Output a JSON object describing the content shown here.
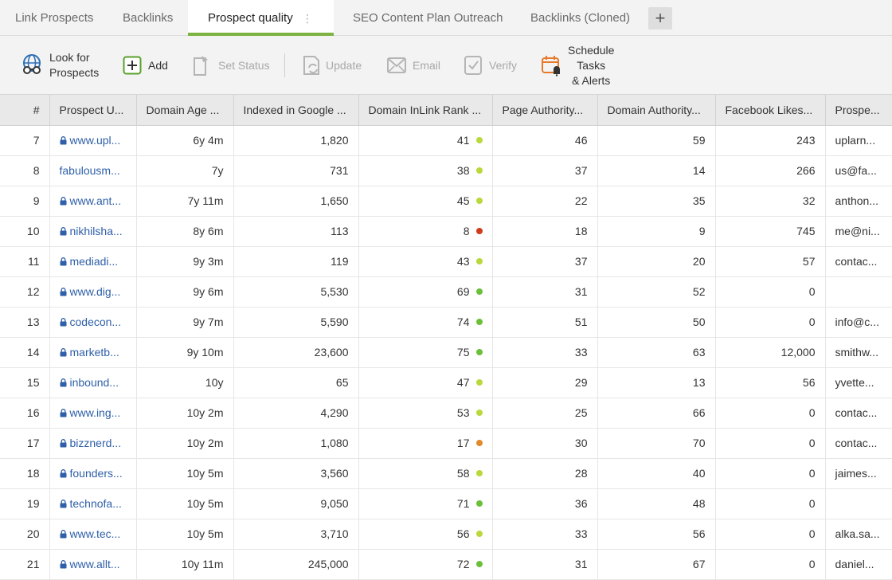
{
  "tabs": [
    {
      "label": "Link Prospects",
      "active": false
    },
    {
      "label": "Backlinks",
      "active": false
    },
    {
      "label": "Prospect quality",
      "active": true
    },
    {
      "label": "SEO Content Plan Outreach",
      "active": false
    },
    {
      "label": "Backlinks (Cloned)",
      "active": false
    }
  ],
  "add_tab_label": "+",
  "toolbar": {
    "look_for_prospects": [
      "Look for",
      "Prospects"
    ],
    "add": "Add",
    "set_status": "Set Status",
    "update": "Update",
    "email": "Email",
    "verify": "Verify",
    "schedule": [
      "Schedule",
      "Tasks",
      "& Alerts"
    ]
  },
  "colors": {
    "accent": "#7cb342",
    "link": "#2e5fa8",
    "rank_high": "#6cbf3a",
    "rank_mid": "#b9d83b",
    "rank_low_orange": "#e08a2c",
    "rank_low_red": "#d13a1c"
  },
  "table": {
    "columns": [
      "#",
      "Prospect U...",
      "Domain Age ...",
      "Indexed in Google ...",
      "Domain InLink Rank ...",
      "Page Authority...",
      "Domain Authority...",
      "Facebook Likes...",
      "Prospe..."
    ],
    "rows": [
      {
        "n": "7",
        "url": "www.upl...",
        "secure": true,
        "age": "6y 4m",
        "indexed": "1,820",
        "rank": "41",
        "rank_color": "mid",
        "pa": "46",
        "da": "59",
        "fb": "243",
        "email": "uplarn..."
      },
      {
        "n": "8",
        "url": "fabulousm...",
        "secure": false,
        "age": "7y",
        "indexed": "731",
        "rank": "38",
        "rank_color": "mid",
        "pa": "37",
        "da": "14",
        "fb": "266",
        "email": "us@fa..."
      },
      {
        "n": "9",
        "url": "www.ant...",
        "secure": true,
        "age": "7y 11m",
        "indexed": "1,650",
        "rank": "45",
        "rank_color": "mid",
        "pa": "22",
        "da": "35",
        "fb": "32",
        "email": "anthon..."
      },
      {
        "n": "10",
        "url": "nikhilsha...",
        "secure": true,
        "age": "8y 6m",
        "indexed": "113",
        "rank": "8",
        "rank_color": "red",
        "pa": "18",
        "da": "9",
        "fb": "745",
        "email": "me@ni..."
      },
      {
        "n": "11",
        "url": "mediadi...",
        "secure": true,
        "age": "9y 3m",
        "indexed": "119",
        "rank": "43",
        "rank_color": "mid",
        "pa": "37",
        "da": "20",
        "fb": "57",
        "email": "contac..."
      },
      {
        "n": "12",
        "url": "www.dig...",
        "secure": true,
        "age": "9y 6m",
        "indexed": "5,530",
        "rank": "69",
        "rank_color": "high",
        "pa": "31",
        "da": "52",
        "fb": "0",
        "email": ""
      },
      {
        "n": "13",
        "url": "codecon...",
        "secure": true,
        "age": "9y 7m",
        "indexed": "5,590",
        "rank": "74",
        "rank_color": "high",
        "pa": "51",
        "da": "50",
        "fb": "0",
        "email": "info@c..."
      },
      {
        "n": "14",
        "url": "marketb...",
        "secure": true,
        "age": "9y 10m",
        "indexed": "23,600",
        "rank": "75",
        "rank_color": "high",
        "pa": "33",
        "da": "63",
        "fb": "12,000",
        "email": "smithw..."
      },
      {
        "n": "15",
        "url": "inbound...",
        "secure": true,
        "age": "10y",
        "indexed": "65",
        "rank": "47",
        "rank_color": "mid",
        "pa": "29",
        "da": "13",
        "fb": "56",
        "email": "yvette..."
      },
      {
        "n": "16",
        "url": "www.ing...",
        "secure": true,
        "age": "10y 2m",
        "indexed": "4,290",
        "rank": "53",
        "rank_color": "mid",
        "pa": "25",
        "da": "66",
        "fb": "0",
        "email": "contac..."
      },
      {
        "n": "17",
        "url": "bizznerd...",
        "secure": true,
        "age": "10y 2m",
        "indexed": "1,080",
        "rank": "17",
        "rank_color": "orange",
        "pa": "30",
        "da": "70",
        "fb": "0",
        "email": "contac..."
      },
      {
        "n": "18",
        "url": "founders...",
        "secure": true,
        "age": "10y 5m",
        "indexed": "3,560",
        "rank": "58",
        "rank_color": "mid",
        "pa": "28",
        "da": "40",
        "fb": "0",
        "email": "jaimes..."
      },
      {
        "n": "19",
        "url": "technofa...",
        "secure": true,
        "age": "10y 5m",
        "indexed": "9,050",
        "rank": "71",
        "rank_color": "high",
        "pa": "36",
        "da": "48",
        "fb": "0",
        "email": ""
      },
      {
        "n": "20",
        "url": "www.tec...",
        "secure": true,
        "age": "10y 5m",
        "indexed": "3,710",
        "rank": "56",
        "rank_color": "mid",
        "pa": "33",
        "da": "56",
        "fb": "0",
        "email": "alka.sa..."
      },
      {
        "n": "21",
        "url": "www.allt...",
        "secure": true,
        "age": "10y 11m",
        "indexed": "245,000",
        "rank": "72",
        "rank_color": "high",
        "pa": "31",
        "da": "67",
        "fb": "0",
        "email": "daniel..."
      }
    ]
  }
}
